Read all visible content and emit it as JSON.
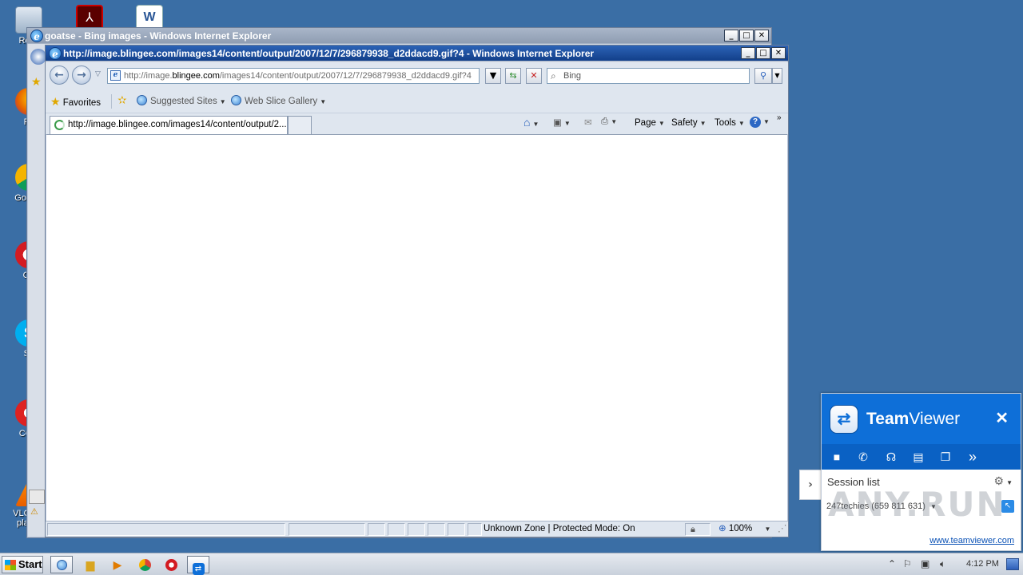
{
  "desktop": {
    "icons": [
      {
        "label": "Recy",
        "name": "recycle-bin"
      },
      {
        "label": "Fir",
        "name": "firefox"
      },
      {
        "label": "Go Chr",
        "name": "google-chrome"
      },
      {
        "label": "Op",
        "name": "opera"
      },
      {
        "label": "Sk",
        "name": "skype"
      },
      {
        "label": "CCle",
        "name": "ccleaner"
      },
      {
        "label": "VLC me player",
        "name": "vlc-media-player"
      }
    ]
  },
  "back_window": {
    "title": "goatse - Bing images - Windows Internet Explorer"
  },
  "ie": {
    "title": "http://image.blingee.com/images14/content/output/2007/12/7/296879938_d2ddacd9.gif?4 - Windows Internet Explorer",
    "address_prefix": "http://image.",
    "address_domain": "blingee.com",
    "address_suffix": "/images14/content/output/2007/12/7/296879938_d2ddacd9.gif?4",
    "search_placeholder": "Bing",
    "favorites_label": "Favorites",
    "suggested_sites": "Suggested Sites",
    "web_slice_gallery": "Web Slice Gallery",
    "tab_label": "http://image.blingee.com/images14/content/output/2...",
    "commands": {
      "page": "Page",
      "safety": "Safety",
      "tools": "Tools"
    },
    "status": {
      "zone": "Unknown Zone | Protected Mode: On",
      "zoom": "100%"
    }
  },
  "teamviewer": {
    "brand_bold": "Team",
    "brand_rest": "Viewer",
    "session_list": "Session list",
    "session_entry": "247techies (659 811 631)",
    "link": "www.teamviewer.com",
    "watermark": "ANY.RUN"
  },
  "taskbar": {
    "start": "Start",
    "clock": "4:12 PM"
  },
  "colors": {
    "desktop": "#3a6ea5",
    "ie_title_active": "#123f8a",
    "teamviewer_blue": "#0e6fd8"
  }
}
